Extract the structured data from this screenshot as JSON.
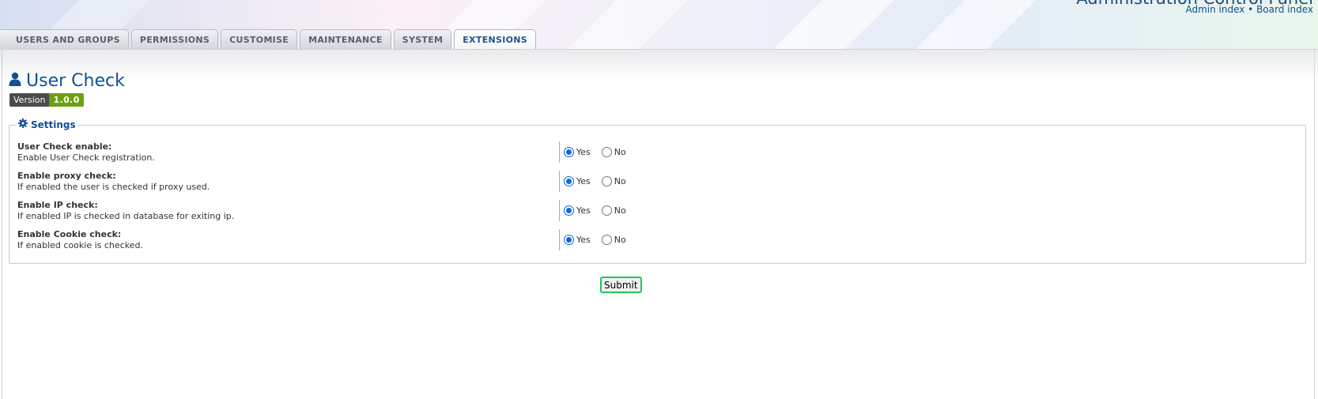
{
  "header": {
    "title": "Administration Control Panel",
    "links": {
      "admin_index": "Admin index",
      "separator": "•",
      "board_index": "Board index"
    }
  },
  "tabs": [
    {
      "label": "USERS AND GROUPS"
    },
    {
      "label": "PERMISSIONS"
    },
    {
      "label": "CUSTOMISE"
    },
    {
      "label": "MAINTENANCE"
    },
    {
      "label": "SYSTEM"
    },
    {
      "label": "EXTENSIONS",
      "active": true
    }
  ],
  "page": {
    "title": "User Check",
    "title_icon": "user-icon",
    "version_label": "Version",
    "version_value": "1.0.0"
  },
  "settings": {
    "legend": "Settings",
    "legend_icon": "gear-icon",
    "yes_label": "Yes",
    "no_label": "No",
    "rows": [
      {
        "term": "User Check enable:",
        "desc": "Enable User Check registration.",
        "value": "Yes"
      },
      {
        "term": "Enable proxy check:",
        "desc": "If enabled the user is checked if proxy used.",
        "value": "Yes"
      },
      {
        "term": "Enable IP check:",
        "desc": "If enabled IP is checked in database for exiting ip.",
        "value": "Yes"
      },
      {
        "term": "Enable Cookie check:",
        "desc": "If enabled cookie is checked.",
        "value": "Yes"
      }
    ]
  },
  "submit_label": "Submit",
  "colors": {
    "accent": "#115098",
    "version_green": "#6aa112",
    "submit_focus": "#21c55e",
    "radio_checked": "#0b6ad9"
  }
}
